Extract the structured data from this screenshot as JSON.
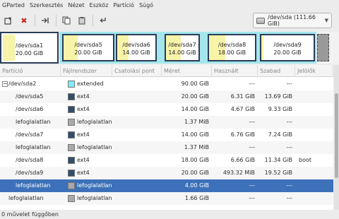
{
  "menu": [
    "GParted",
    "Szerkesztés",
    "Nézet",
    "Eszköz",
    "Partíció",
    "Súgó"
  ],
  "toolbar": {
    "icons": [
      "new-partition-icon",
      "delete-icon",
      "resize-move-icon",
      "copy-icon",
      "paste-icon",
      "undo-icon"
    ]
  },
  "device": {
    "label": "/dev/sda  (111.66 GiB)"
  },
  "graph": [
    {
      "name": "/dev/sda1",
      "size": "20.00 GiB"
    },
    {
      "name": "/dev/sda5",
      "size": "20.00 GiB"
    },
    {
      "name": "/dev/sda6",
      "size": "14.00 GiB"
    },
    {
      "name": "/dev/sda7",
      "size": "14.00 GiB"
    },
    {
      "name": "/dev/sda8",
      "size": "18.00 GiB"
    },
    {
      "name": "/dev/sda9",
      "size": "20.00 GiB"
    }
  ],
  "columns": {
    "partition": "Partíció",
    "filesystem": "Fájlrendszer",
    "mountpoint": "Csatolási pont",
    "size": "Méret",
    "used": "Használt",
    "free": "Szabad",
    "flags": "Jelölők"
  },
  "rows": [
    {
      "partition": "/dev/sda2",
      "filesystem": "extended",
      "fs_color": "#7dedf7",
      "size": "90.00 GiB",
      "used": "---",
      "free": "---",
      "flags": "",
      "indent": 0,
      "expander": "−"
    },
    {
      "partition": "/dev/sda5",
      "filesystem": "ext4",
      "fs_color": "#314e6c",
      "size": "20.00 GiB",
      "used": "6.31 GiB",
      "free": "13.69 GiB",
      "flags": "",
      "indent": 1
    },
    {
      "partition": "/dev/sda6",
      "filesystem": "ext4",
      "fs_color": "#314e6c",
      "size": "14.00 GiB",
      "used": "4.67 GiB",
      "free": "9.33 GiB",
      "flags": "",
      "indent": 1
    },
    {
      "partition": "lefoglalatlan",
      "filesystem": "lefoglalatlan",
      "fs_color": "#a9a9a9",
      "size": "1.37 MiB",
      "used": "---",
      "free": "---",
      "flags": "",
      "indent": 1
    },
    {
      "partition": "/dev/sda7",
      "filesystem": "ext4",
      "fs_color": "#314e6c",
      "size": "14.00 GiB",
      "used": "6.76 GiB",
      "free": "7.24 GiB",
      "flags": "",
      "indent": 1
    },
    {
      "partition": "lefoglalatlan",
      "filesystem": "lefoglalatlan",
      "fs_color": "#a9a9a9",
      "size": "1.37 MiB",
      "used": "---",
      "free": "---",
      "flags": "",
      "indent": 1
    },
    {
      "partition": "/dev/sda8",
      "filesystem": "ext4",
      "fs_color": "#314e6c",
      "size": "18.00 GiB",
      "used": "6.66 GiB",
      "free": "11.34 GiB",
      "flags": "boot",
      "indent": 1
    },
    {
      "partition": "/dev/sda9",
      "filesystem": "ext4",
      "fs_color": "#314e6c",
      "size": "20.00 GiB",
      "used": "493.32 MiB",
      "free": "19.52 GiB",
      "flags": "",
      "indent": 1
    },
    {
      "partition": "lefoglalatlan",
      "filesystem": "lefoglalatlan",
      "fs_color": "#a9a9a9",
      "size": "4.00 GiB",
      "used": "---",
      "free": "---",
      "flags": "",
      "indent": 1,
      "selected": true
    },
    {
      "partition": "lefoglalatlan",
      "filesystem": "lefoglalatlan",
      "fs_color": "#a9a9a9",
      "size": "1.66 GiB",
      "used": "---",
      "free": "---",
      "flags": "",
      "indent": 0
    }
  ],
  "status": "0 művelet függőben"
}
